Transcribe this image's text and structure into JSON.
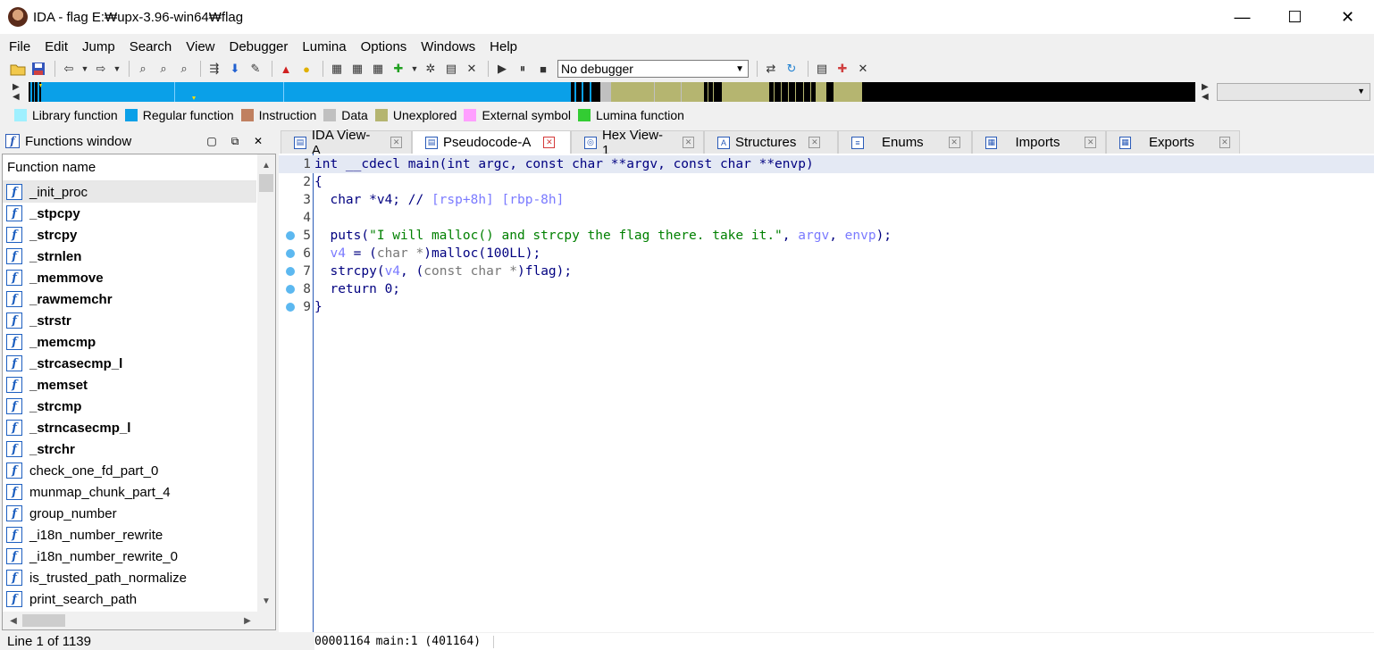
{
  "window": {
    "title": "IDA - flag E:₩upx-3.96-win64₩flag",
    "controls": [
      "—",
      "☐",
      "✕"
    ]
  },
  "menu": [
    "File",
    "Edit",
    "Jump",
    "Search",
    "View",
    "Debugger",
    "Lumina",
    "Options",
    "Windows",
    "Help"
  ],
  "toolbar": {
    "debugger_select": "No debugger"
  },
  "legend": [
    {
      "label": "Library function",
      "color": "#9ff0ff"
    },
    {
      "label": "Regular function",
      "color": "#0aa0e8"
    },
    {
      "label": "Instruction",
      "color": "#c08060"
    },
    {
      "label": "Data",
      "color": "#c0c0c0"
    },
    {
      "label": "Unexplored",
      "color": "#b5b570"
    },
    {
      "label": "External symbol",
      "color": "#ff9fff"
    },
    {
      "label": "Lumina function",
      "color": "#33cc33"
    }
  ],
  "functions_window": {
    "title": "Functions window",
    "column": "Function name",
    "items": [
      {
        "name": "_init_proc",
        "bold": false
      },
      {
        "name": "_stpcpy",
        "bold": true
      },
      {
        "name": "_strcpy",
        "bold": true
      },
      {
        "name": "_strnlen",
        "bold": true
      },
      {
        "name": "_memmove",
        "bold": true
      },
      {
        "name": "_rawmemchr",
        "bold": true
      },
      {
        "name": "_strstr",
        "bold": true
      },
      {
        "name": "_memcmp",
        "bold": true
      },
      {
        "name": "_strcasecmp_l",
        "bold": true
      },
      {
        "name": "_memset",
        "bold": true
      },
      {
        "name": "_strcmp",
        "bold": true
      },
      {
        "name": "_strncasecmp_l",
        "bold": true
      },
      {
        "name": "_strchr",
        "bold": true
      },
      {
        "name": "check_one_fd_part_0",
        "bold": false
      },
      {
        "name": "munmap_chunk_part_4",
        "bold": false
      },
      {
        "name": "group_number",
        "bold": false
      },
      {
        "name": "_i18n_number_rewrite",
        "bold": false
      },
      {
        "name": "_i18n_number_rewrite_0",
        "bold": false
      },
      {
        "name": "is_trusted_path_normalize",
        "bold": false
      },
      {
        "name": "print_search_path",
        "bold": false
      }
    ],
    "status": "Line 1 of 1139"
  },
  "tabs": [
    {
      "label": "IDA View-A",
      "icon": "▤",
      "active": false
    },
    {
      "label": "Pseudocode-A",
      "icon": "▤",
      "active": true
    },
    {
      "label": "Hex View-1",
      "icon": "◎",
      "active": false
    },
    {
      "label": "Structures",
      "icon": "A",
      "active": false
    },
    {
      "label": "Enums",
      "icon": "≡",
      "active": false
    },
    {
      "label": "Imports",
      "icon": "▦",
      "active": false
    },
    {
      "label": "Exports",
      "icon": "▦",
      "active": false
    }
  ],
  "code": {
    "lines": [
      {
        "no": "1",
        "dot": false
      },
      {
        "no": "2",
        "dot": false
      },
      {
        "no": "3",
        "dot": false
      },
      {
        "no": "4",
        "dot": false
      },
      {
        "no": "5",
        "dot": true
      },
      {
        "no": "6",
        "dot": true
      },
      {
        "no": "7",
        "dot": true
      },
      {
        "no": "8",
        "dot": true
      },
      {
        "no": "9",
        "dot": true
      }
    ],
    "l1": "int __cdecl main(int argc, const char **argv, const char **envp)",
    "l2": "{",
    "l3_decl": "  char *v4; // ",
    "l3_cmt": "[rsp+8h] [rbp-8h]",
    "l5_a": "  puts(",
    "l5_str": "\"I will malloc() and strcpy the flag there. take it.\"",
    "l5_b": ", ",
    "l5_argv": "argv",
    "l5_c": ", ",
    "l5_envp": "envp",
    "l5_d": ");",
    "l6_v4": "  v4",
    "l6_a": " = (",
    "l6_cast": "char *",
    "l6_b": ")malloc(100LL);",
    "l7_a": "  strcpy(",
    "l7_v4": "v4",
    "l7_b": ", (",
    "l7_cast": "const char *",
    "l7_c": ")flag);",
    "l8": "  return 0;",
    "l9": "}",
    "status_addr": "00001164",
    "status_loc": "main:1 (401164)"
  }
}
